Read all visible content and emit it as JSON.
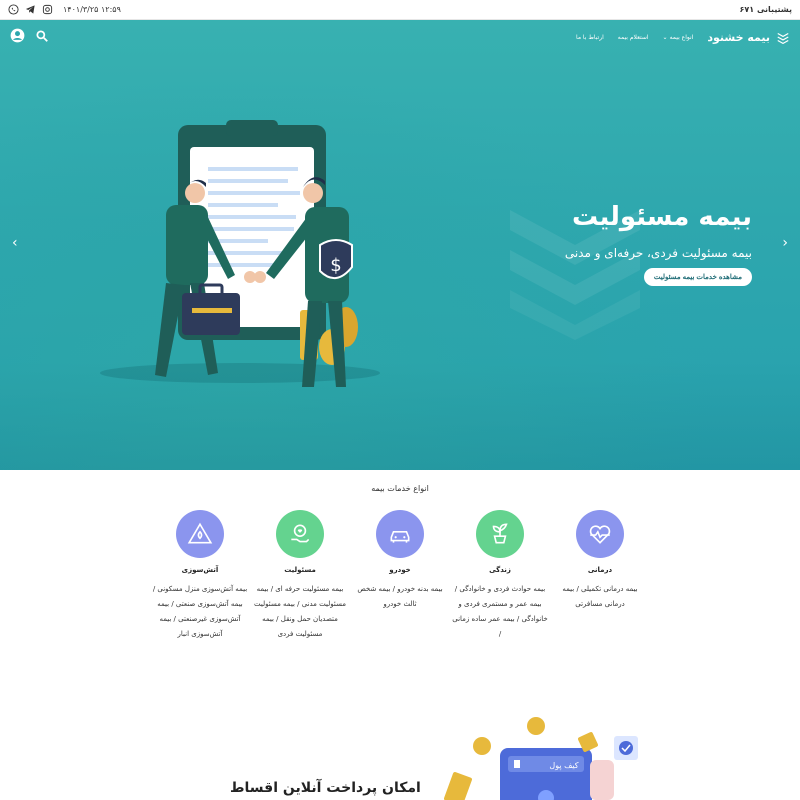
{
  "topbar": {
    "support_label": "پشتیبانی ۶۷۱",
    "datetime": "۱۴۰۱/۳/۲۵  ۱۲:۵۹",
    "icons": [
      "whatsapp-icon",
      "telegram-icon",
      "instagram-icon"
    ]
  },
  "nav": {
    "brand": "بیمه خشنود",
    "items": [
      {
        "label": "انواع بیمه"
      },
      {
        "label": "استعلام بیمه"
      },
      {
        "label": "ارتباط با ما"
      }
    ],
    "icons": [
      "user-icon",
      "search-icon"
    ]
  },
  "hero": {
    "title": "بیمه مسئولیت",
    "subtitle": "بیمه مسئولیت فردی، حرفه‌ای و مدنی",
    "button": "مشاهده خدمات بیمه مسئولیت",
    "colors": {
      "bg_top": "#38b1b1",
      "bg_bottom": "#26a0ae",
      "figure": "#1f5e58",
      "accent": "#e7b93c"
    }
  },
  "services": {
    "title": "انواع خدمات بیمه",
    "items": [
      {
        "name": "درمانی",
        "desc": "بیمه درمانی تکمیلی / بیمه درمانی مسافرتی",
        "icon": "heartbeat-icon",
        "color": "#8b95ee"
      },
      {
        "name": "زندگی",
        "desc": "بیمه حوادث فردی و خانوادگی / بیمه عمر و مستمری فردی و خانوادگی / بیمه عمر ساده زمانی /",
        "icon": "plant-icon",
        "color": "#64d38f"
      },
      {
        "name": "خودرو",
        "desc": "بیمه بدنه خودرو / بیمه شخص ثالث خودرو",
        "icon": "car-icon",
        "color": "#8b95ee"
      },
      {
        "name": "مسئولیت",
        "desc": "بیمه مسئولیت حرفه ای / بیمه مسئولیت مدنی / بیمه مسئولیت متصدیان حمل ونقل / بیمه مسئولیت فردی",
        "icon": "hand-heart-icon",
        "color": "#64d38f"
      },
      {
        "name": "آتش‌سوزی",
        "desc": "بیمه آتش‌سوزی منزل مسکونی / بیمه آتش‌سوزی صنعتی / بیمه آتش‌سوزی غیرصنعتی / بیمه آتش‌سوزی انبار",
        "icon": "fire-warning-icon",
        "color": "#8b95ee"
      }
    ]
  },
  "promo": {
    "title": "امکان پرداخت آنلاین اقساط",
    "wallet_label": "کیف پول"
  }
}
